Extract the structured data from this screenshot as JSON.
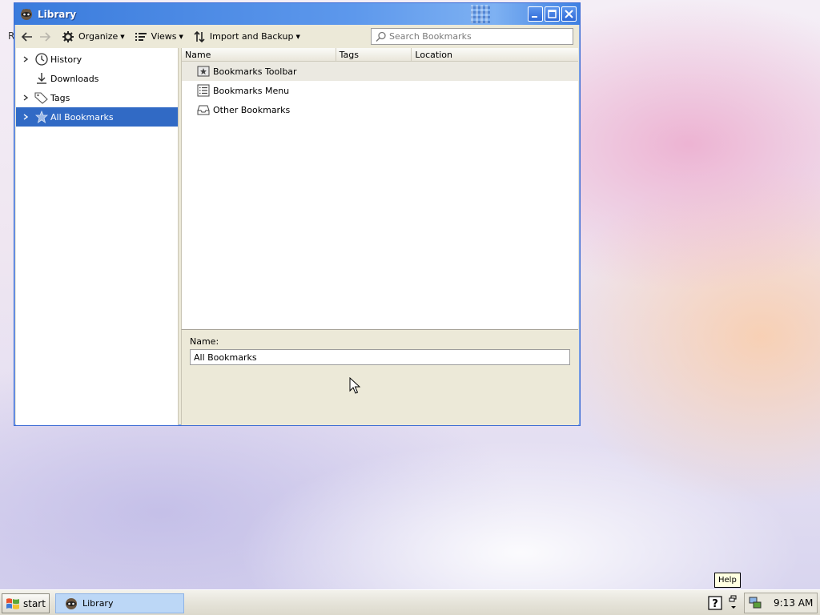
{
  "window": {
    "title": "Library"
  },
  "toolbar": {
    "organize_label": "Organize",
    "views_label": "Views",
    "import_backup_label": "Import and Backup",
    "search_placeholder": "Search Bookmarks"
  },
  "sidebar": {
    "items": [
      {
        "label": "History",
        "icon": "clock-icon",
        "expandable": true,
        "selected": false
      },
      {
        "label": "Downloads",
        "icon": "download-icon",
        "expandable": false,
        "selected": false
      },
      {
        "label": "Tags",
        "icon": "tag-icon",
        "expandable": true,
        "selected": false
      },
      {
        "label": "All Bookmarks",
        "icon": "star-icon",
        "expandable": true,
        "selected": true
      }
    ]
  },
  "columns": {
    "name": "Name",
    "tags": "Tags",
    "location": "Location"
  },
  "rows": [
    {
      "name": "Bookmarks Toolbar",
      "icon": "bookmarks-toolbar-icon"
    },
    {
      "name": "Bookmarks Menu",
      "icon": "bookmarks-menu-icon"
    },
    {
      "name": "Other Bookmarks",
      "icon": "folder-tray-icon"
    }
  ],
  "details": {
    "name_label": "Name:",
    "name_value": "All Bookmarks"
  },
  "desktop": {
    "edge_char": "R"
  },
  "taskbar": {
    "start_label": "start",
    "task_label": "Library",
    "tooltip": "Help",
    "clock": "9:13 AM"
  },
  "colors": {
    "titlebar": "#3a7bdc",
    "selection": "#316ac5",
    "tooltip_bg": "#ffffe1"
  }
}
